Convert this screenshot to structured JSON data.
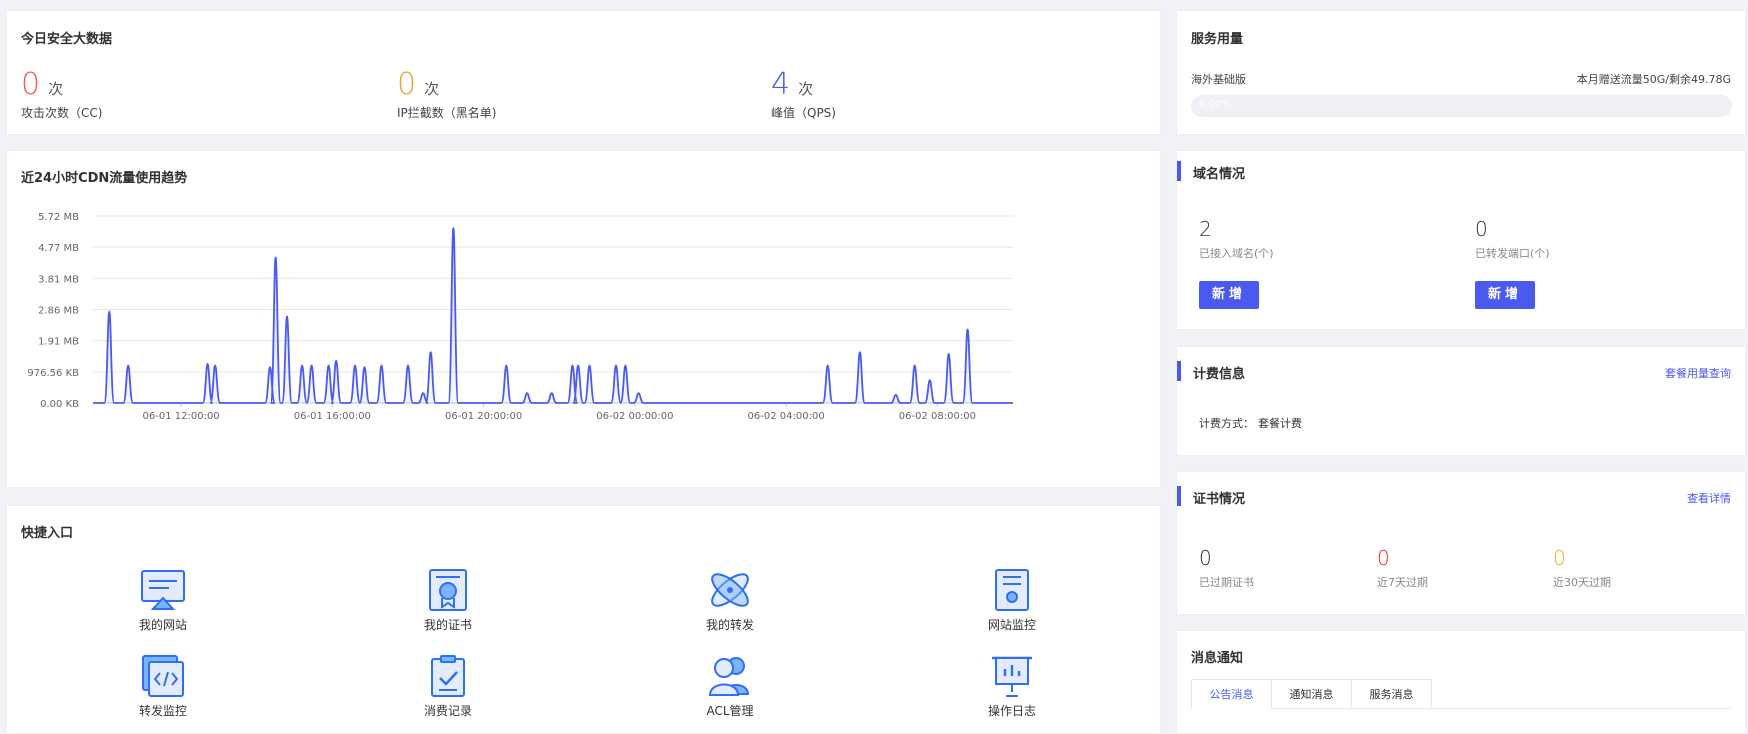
{
  "security": {
    "title": "今日安全大数据",
    "stats": [
      {
        "value": "0",
        "unit": "次",
        "label": "攻击次数（CC)",
        "color": "#f05d5d"
      },
      {
        "value": "0",
        "unit": "次",
        "label": "IP拦截数（黑名单)",
        "color": "#e6a23c"
      },
      {
        "value": "4",
        "unit": "次",
        "label": "峰值（QPS)",
        "color": "#4a5aef"
      }
    ]
  },
  "usage": {
    "title": "服务用量",
    "plan": "海外基础版",
    "quota": "本月赠送流量50G/剩余49.78G",
    "progress_text": "0.00%",
    "progress": 0.0
  },
  "chart_title": "近24小时CDN流量使用趋势",
  "chart_data": {
    "type": "area",
    "y_ticks": [
      "5.72 MB",
      "4.77 MB",
      "3.81 MB",
      "2.86 MB",
      "1.91 MB",
      "976.56 KB",
      "0.00 KB"
    ],
    "x_ticks": [
      "06-01 12:00:00",
      "06-01 16:00:00",
      "06-01 20:00:00",
      "06-02 00:00:00",
      "06-02 04:00:00",
      "06-02 08:00:00"
    ],
    "ylim": [
      0,
      5.72
    ],
    "xlim": [
      9.67,
      34.0
    ],
    "line_color": "#4a5aef",
    "series": [
      {
        "points": [
          [
            10.1,
            2.8
          ],
          [
            10.6,
            1.15
          ],
          [
            12.7,
            1.2
          ],
          [
            12.9,
            1.15
          ],
          [
            14.35,
            1.1
          ],
          [
            14.5,
            4.45
          ],
          [
            14.8,
            2.65
          ],
          [
            15.2,
            1.15
          ],
          [
            15.45,
            1.15
          ],
          [
            15.9,
            1.15
          ],
          [
            16.1,
            1.3
          ],
          [
            16.6,
            1.15
          ],
          [
            16.85,
            1.1
          ],
          [
            17.3,
            1.15
          ],
          [
            18.0,
            1.15
          ],
          [
            18.4,
            0.3
          ],
          [
            18.6,
            1.55
          ],
          [
            19.2,
            5.35
          ],
          [
            20.6,
            1.15
          ],
          [
            21.15,
            0.3
          ],
          [
            21.8,
            0.3
          ],
          [
            22.35,
            1.15
          ],
          [
            22.5,
            1.15
          ],
          [
            22.8,
            1.15
          ],
          [
            23.5,
            1.15
          ],
          [
            23.75,
            1.15
          ],
          [
            24.1,
            0.3
          ],
          [
            29.1,
            1.15
          ],
          [
            29.95,
            1.55
          ],
          [
            30.9,
            0.25
          ],
          [
            31.4,
            1.15
          ],
          [
            31.8,
            0.7
          ],
          [
            32.3,
            1.5
          ],
          [
            32.8,
            2.25
          ]
        ]
      }
    ]
  },
  "domain": {
    "title": "域名情况",
    "items": [
      {
        "value": "2",
        "label": "已接入域名(个)",
        "button": "新增"
      },
      {
        "value": "0",
        "label": "已转发端口(个)",
        "button": "新增"
      }
    ]
  },
  "billing": {
    "title": "计费信息",
    "link": "套餐用量查询",
    "method_label": "计费方式：",
    "method_value": "套餐计费"
  },
  "cert": {
    "title": "证书情况",
    "link": "查看详情",
    "items": [
      {
        "value": "0",
        "label": "已过期证书",
        "color": "#303133"
      },
      {
        "value": "0",
        "label": "近7天过期",
        "color": "#f5222d"
      },
      {
        "value": "0",
        "label": "近30天过期",
        "color": "#f5a623"
      }
    ]
  },
  "quick": {
    "title": "快捷入口",
    "items": [
      {
        "label": "我的网站",
        "icon": "website-icon"
      },
      {
        "label": "我的证书",
        "icon": "certificate-icon"
      },
      {
        "label": "我的转发",
        "icon": "forward-icon"
      },
      {
        "label": "网站监控",
        "icon": "monitor-icon"
      },
      {
        "label": "转发监控",
        "icon": "code-window-icon"
      },
      {
        "label": "消费记录",
        "icon": "clipboard-check-icon"
      },
      {
        "label": "ACL管理",
        "icon": "users-icon"
      },
      {
        "label": "操作日志",
        "icon": "presentation-icon"
      }
    ]
  },
  "messages": {
    "title": "消息通知",
    "tabs": [
      "公告消息",
      "通知消息",
      "服务消息"
    ],
    "active_tab": 0
  }
}
